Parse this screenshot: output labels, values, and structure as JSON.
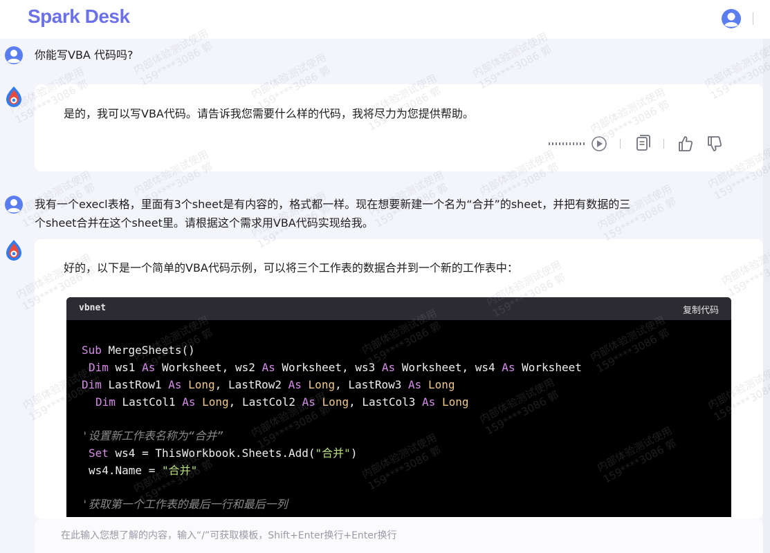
{
  "app": {
    "logo": "Spark Desk"
  },
  "conversation": [
    {
      "role": "user",
      "text": "你能写VBA 代码吗?"
    },
    {
      "role": "assistant",
      "text": "是的，我可以写VBA代码。请告诉我您需要什么样的代码，我将尽力为您提供帮助。"
    },
    {
      "role": "user",
      "line1": "我有一个execl表格，里面有3个sheet是有内容的，格式都一样。现在想要新建一个名为“合并”的sheet，并把有数据的三",
      "line2": "个sheet合并在这个sheet里。请根据这个需求用VBA代码实现给我。"
    },
    {
      "role": "assistant",
      "text": "好的，以下是一个简单的VBA代码示例，可以将三个工作表的数据合并到一个新的工作表中："
    }
  ],
  "code_block": {
    "language": "vbnet",
    "copy_label": "复制代码",
    "comment1": "'设置新工作表名称为“合并”",
    "comment2": "'获取第一个工作表的最后一行和最后一列",
    "string_add": "\"合并\"",
    "string_name": "\"合并\""
  },
  "input": {
    "placeholder": "在此输入您想了解的内容，输入“/”可获取模板，Shift+Enter换行+Enter换行"
  },
  "watermark": {
    "line1": "内部体验测试使用",
    "line2": "159****3086 郭"
  },
  "colors": {
    "brand": "#6b71e8",
    "page_bg": "#f4f5fa",
    "code_bg": "#000000",
    "code_header_bg": "#2b2b31",
    "keyword": "#d58ce8",
    "type": "#f0c98a",
    "string": "#b7e07a",
    "comment": "#8a8a8a"
  },
  "icons": [
    "user-avatar-icon",
    "spark-logo-icon",
    "audio-play-icon",
    "copy-icon",
    "thumbs-up-icon",
    "thumbs-down-icon"
  ]
}
